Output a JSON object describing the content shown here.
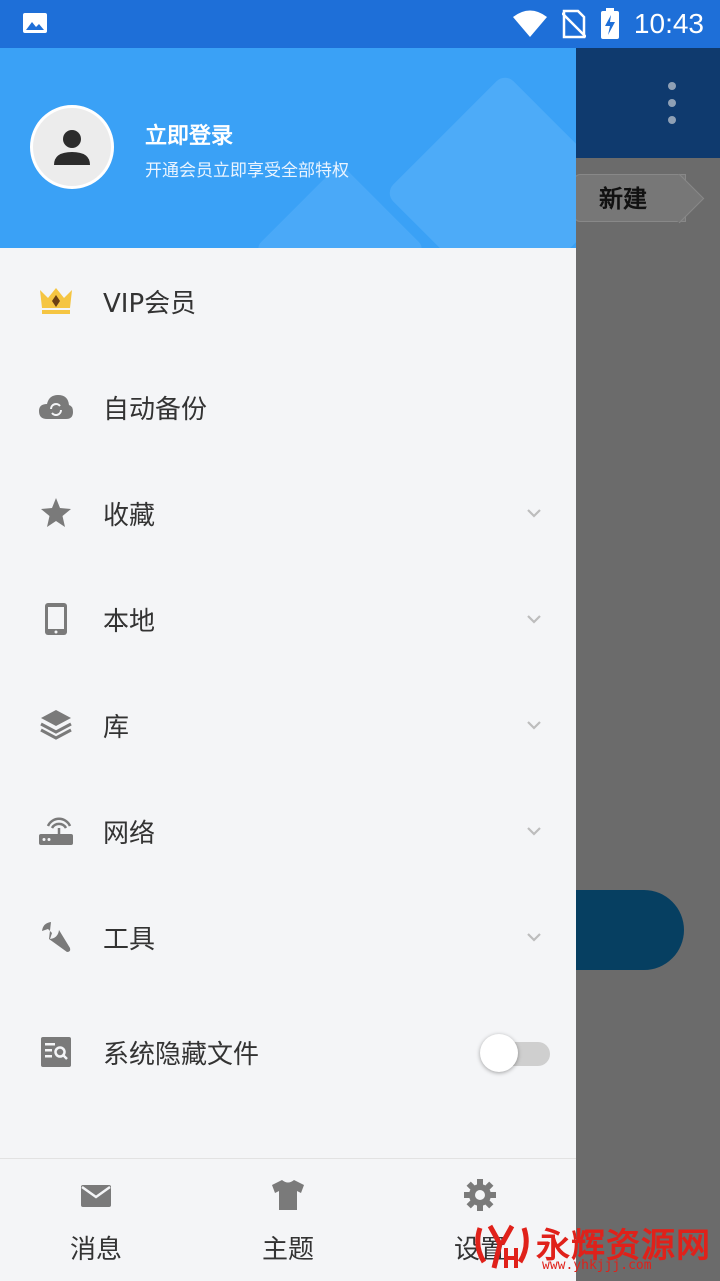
{
  "status_bar": {
    "time": "10:43"
  },
  "background": {
    "chip_label": "新建"
  },
  "drawer": {
    "login_title": "立即登录",
    "login_subtitle": "开通会员立即享受全部特权",
    "items": [
      {
        "label": "VIP会员",
        "icon": "crown-icon"
      },
      {
        "label": "自动备份",
        "icon": "cloud-sync-icon"
      },
      {
        "label": "收藏",
        "icon": "star-icon",
        "expandable": true
      },
      {
        "label": "本地",
        "icon": "phone-icon",
        "expandable": true
      },
      {
        "label": "库",
        "icon": "layers-icon",
        "expandable": true
      },
      {
        "label": "网络",
        "icon": "router-icon",
        "expandable": true
      },
      {
        "label": "工具",
        "icon": "wrench-icon",
        "expandable": true
      },
      {
        "label": "系统隐藏文件",
        "icon": "search-doc-icon",
        "toggle": false
      }
    ],
    "bottom_tabs": [
      {
        "label": "消息",
        "icon": "mail-icon"
      },
      {
        "label": "主题",
        "icon": "shirt-icon"
      },
      {
        "label": "设置",
        "icon": "gear-icon"
      }
    ]
  },
  "watermark": {
    "text": "永辉资源网",
    "url": "www.yhkjjj.com"
  },
  "colors": {
    "status_bar": "#1e6fd8",
    "header": "#3aa1f6",
    "icon_gray": "#7a7a7a",
    "crown_gold": "#f5c542"
  }
}
